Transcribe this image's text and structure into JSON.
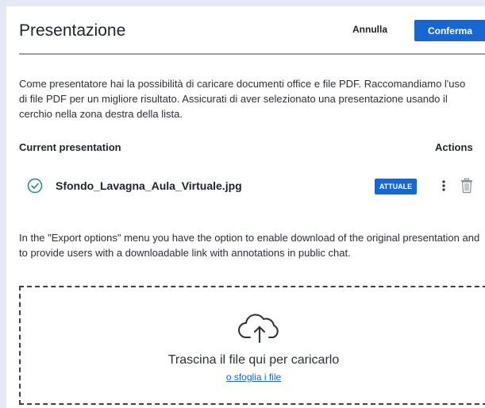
{
  "header": {
    "title": "Presentazione",
    "cancel_label": "Annulla",
    "confirm_label": "Conferma"
  },
  "description": "Come presentatore hai la possibilità di caricare documenti office e file PDF. Raccomandiamo l'uso di file PDF per un migliore risultato. Assicurati di aver selezionato una presentazione usando il cerchio nella zona destra della lista.",
  "table": {
    "col_current": "Current presentation",
    "col_actions": "Actions",
    "rows": [
      {
        "filename": "Sfondo_Lavagna_Aula_Virtuale.jpg",
        "badge": "ATTUALE",
        "selected": true
      }
    ]
  },
  "export_info": "In the \"Export options\" menu you have the option to enable download of the original presentation and to provide users with a downloadable link with annotations in public chat.",
  "dropzone": {
    "text": "Trascina il file qui per caricarlo",
    "browse_label": "o sfoglia i file",
    "icon": "cloud-upload-icon"
  },
  "colors": {
    "accent": "#1766d1",
    "background": "#e4e8f4",
    "selected_check": "#1a8a8a"
  }
}
